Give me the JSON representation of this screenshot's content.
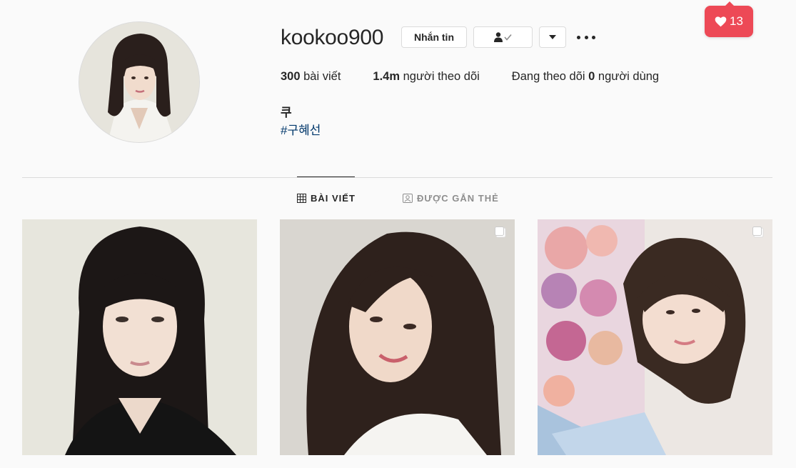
{
  "profile": {
    "username": "kookoo900",
    "message_button": "Nhắn tin",
    "follow_icon": "person-check-icon",
    "dropdown_icon": "caret-down-icon",
    "more_icon": "ellipsis-icon"
  },
  "stats": {
    "posts_count": "300",
    "posts_label": "bài viết",
    "followers_count": "1.4m",
    "followers_label": "người theo dõi",
    "following_prefix": "Đang theo dõi",
    "following_count": "0",
    "following_label": "người dùng"
  },
  "bio": {
    "name": "쿠",
    "hashtag": "#구혜선"
  },
  "tabs": [
    {
      "label": "BÀI VIẾT",
      "icon": "grid-icon",
      "active": true
    },
    {
      "label": "ĐƯỢC GẮN THẺ",
      "icon": "tag-portrait-icon",
      "active": false
    }
  ],
  "notification": {
    "icon": "heart-icon",
    "count": "13",
    "color": "#ed4956"
  },
  "posts": [
    {
      "type": "image",
      "multi": false
    },
    {
      "type": "image",
      "multi": true,
      "icon": "multiple-images-icon"
    },
    {
      "type": "image",
      "multi": true,
      "icon": "multiple-images-icon"
    }
  ],
  "colors": {
    "background": "#fafafa",
    "text": "#262626",
    "muted": "#8e8e8e",
    "link": "#00376b",
    "border": "#dbdbdb"
  }
}
